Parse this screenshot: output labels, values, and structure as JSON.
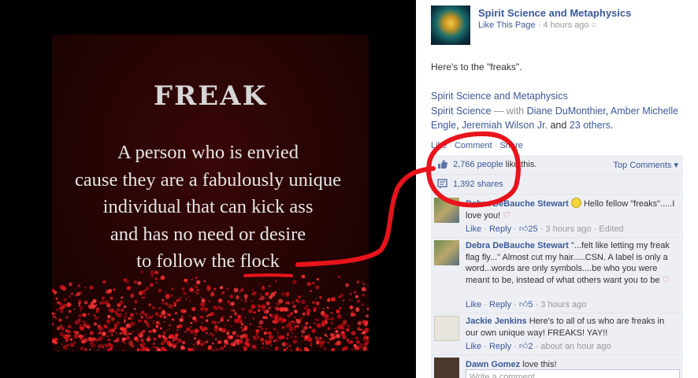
{
  "photo": {
    "title": "FREAK",
    "lines": [
      "A person who is envied",
      "cause they are a fabulously unique",
      "individual that can kick ass",
      "and has no need or desire",
      "to follow the flock"
    ]
  },
  "post": {
    "page_name": "Spirit Science and Metaphysics",
    "like_page": "Like This Page",
    "time": "4 hours ago",
    "message": "Here's to the \"freaks\".",
    "attachment_title": "Spirit Science and Metaphysics",
    "album": "Spirit Science",
    "with_text": " — with ",
    "tagged": [
      "Diane DuMonthier",
      "Amber Michelle Engle",
      "Jeremiah Wilson Jr."
    ],
    "and_text": " and ",
    "others": "23 others",
    "actions": [
      "Like",
      "Comment",
      "Share"
    ]
  },
  "stats": {
    "likes_count": "2,766 people",
    "likes_suffix": " like this.",
    "shares": "1,392 shares",
    "top_comments": "Top Comments"
  },
  "comments": [
    {
      "name": "Debra DeBauche Stewart",
      "text": " Hello fellow \"freaks\".....I love you!",
      "like": "Like",
      "reply": "Reply",
      "likes": "25",
      "time": "3 hours ago",
      "extra": "Edited"
    },
    {
      "name": "Debra DeBauche Stewart",
      "text": " \"...felt like letting my freak flag fly...\" Almost cut my hair.....CSN. A label is only a word...words are only symbols....be who you were meant to be, instead of what others want you to be",
      "like": "Like",
      "reply": "Reply",
      "likes": "5",
      "time": "3 hours ago"
    },
    {
      "name": "Jackie Jenkins",
      "text": " Here's to all of us who are freaks in our own unique way! FREAKS! YAY!!",
      "like": "Like",
      "reply": "Reply",
      "likes": "2",
      "time": "about an hour ago"
    },
    {
      "name": "Dawn Gomez",
      "text": " love this!"
    }
  ],
  "composer": {
    "placeholder": "Write a comment..."
  },
  "colors": {
    "link": "#3b5998",
    "annotation": "#e8131b",
    "ufi_bg": "#edeff4"
  }
}
